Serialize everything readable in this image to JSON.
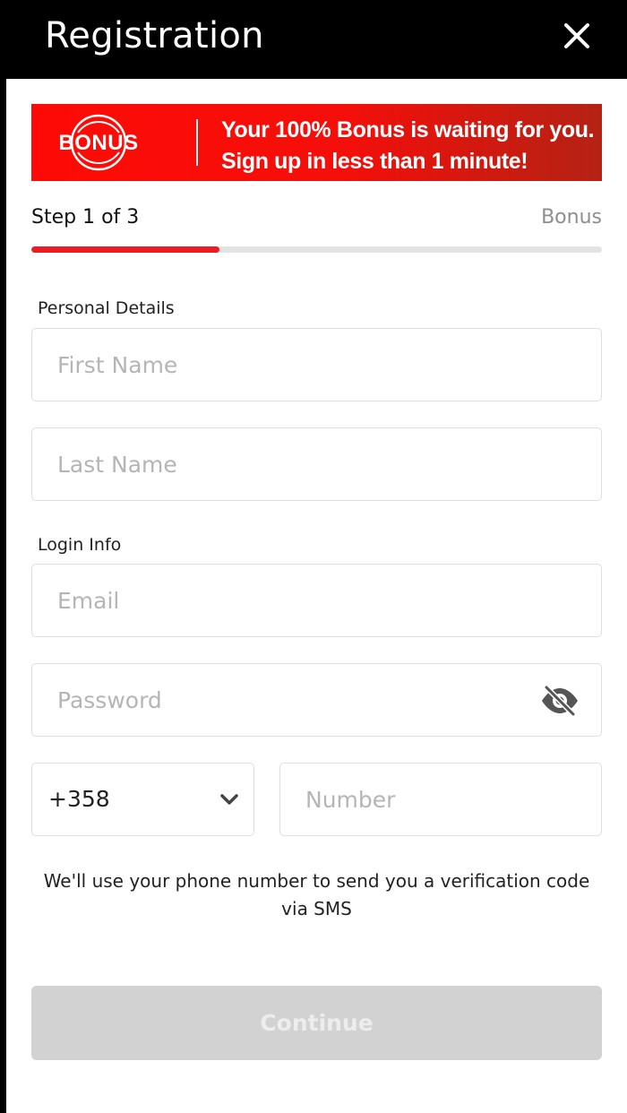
{
  "header": {
    "title": "Registration",
    "close_icon": "close-icon"
  },
  "banner": {
    "logo_text": "BONUS",
    "line1": "Your 100% Bonus is waiting for you.",
    "line2": "Sign up in less than 1 minute!",
    "accent_color": "#ff0a06"
  },
  "progress": {
    "step_label": "Step 1 of 3",
    "end_label": "Bonus",
    "fraction": 0.33,
    "fill_color": "#ee1b24"
  },
  "personal": {
    "section_label": "Personal Details",
    "first_name_placeholder": "First Name",
    "first_name_value": "",
    "last_name_placeholder": "Last Name",
    "last_name_value": ""
  },
  "login": {
    "section_label": "Login Info",
    "email_placeholder": "Email",
    "email_value": "",
    "password_placeholder": "Password",
    "password_value": "",
    "visibility_icon": "eye-off-icon"
  },
  "phone": {
    "country_code": "+358",
    "dropdown_icon": "chevron-down-icon",
    "number_placeholder": "Number",
    "number_value": "",
    "note": "We'll use your phone number to send you a verification code via SMS"
  },
  "actions": {
    "continue_label": "Continue"
  }
}
